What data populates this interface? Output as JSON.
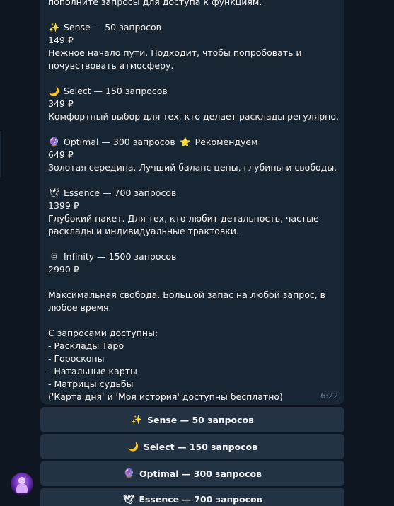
{
  "message": {
    "top_partial": "пополните запросы для доступа к функциям.",
    "plans": [
      {
        "icon": "sparkles-icon",
        "glyph": "✨",
        "title": "Sense — 50 запросов",
        "badge": "",
        "price": "149 ₽",
        "desc": [
          "Нежное начало пути. Подходит, чтобы попробовать и",
          "почувствовать атмосферу."
        ]
      },
      {
        "icon": "crescent-moon-icon",
        "glyph": "🌙",
        "title": "Select — 150 запросов",
        "badge": "",
        "price": "349 ₽",
        "desc": [
          "Комфортный выбор для тех, кто делает расклады регулярно."
        ]
      },
      {
        "icon": "crystal-ball-icon",
        "glyph": "🔮",
        "title": "Optimal — 300 запросов",
        "badge": "Рекомендуем",
        "badge_glyph": "⭐",
        "price": "649 ₽",
        "desc": [
          "Золотая середина. Лучший баланс цены, глубины и свободы."
        ]
      },
      {
        "icon": "dove-icon",
        "glyph": "🕊",
        "title": "Essence — 700 запросов",
        "badge": "",
        "price": "1399 ₽",
        "desc": [
          "Глубокий пакет. Для тех, кто любит детальность, частые",
          "расклады и индивидуальные трактовки."
        ]
      },
      {
        "icon": "infinity-icon",
        "glyph": "♾",
        "title": "Infinity — 1500 запросов",
        "badge": "",
        "price": "2990 ₽",
        "desc": []
      }
    ],
    "freedom": [
      "Максимальная свобода. Большой запас на любой запрос, в",
      "любое время."
    ],
    "available_title": "С запросами доступны:",
    "available_items": [
      "- Расклады Таро",
      "- Гороскопы",
      "- Натальные карты",
      "- Матрицы судьбы"
    ],
    "free_note": "('Карта дня' и 'Моя история' доступны бесплатно)",
    "time": "6:22"
  },
  "keyboard": [
    {
      "glyph": "✨",
      "icon": "sparkles-icon",
      "label": "Sense — 50 запросов"
    },
    {
      "glyph": "🌙",
      "icon": "crescent-moon-icon",
      "label": "Select — 150 запросов"
    },
    {
      "glyph": "🔮",
      "icon": "crystal-ball-icon",
      "label": "Optimal — 300 запросов"
    },
    {
      "glyph": "🕊",
      "icon": "dove-icon",
      "label": "Essence — 700 запросов"
    }
  ]
}
